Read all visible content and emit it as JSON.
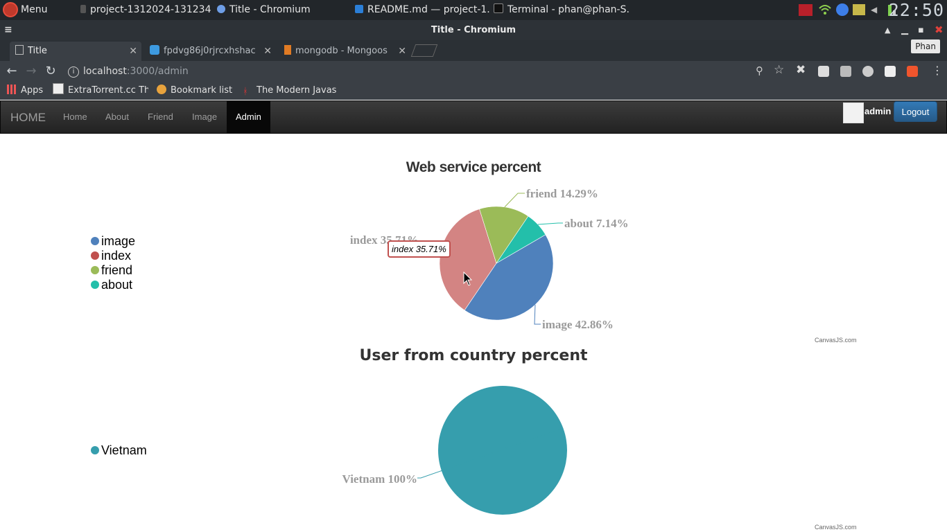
{
  "taskbar": {
    "menu_label": "Menu",
    "tasks": [
      {
        "label": "project-1312024-131234..."
      },
      {
        "label": "Title - Chromium"
      },
      {
        "label": "README.md — project-1..."
      },
      {
        "label": "Terminal - phan@phan-S..."
      }
    ],
    "clock": "22:50"
  },
  "window": {
    "title": "Title - Chromium"
  },
  "tabs": [
    {
      "label": "Title"
    },
    {
      "label": "fpdvg86j0rjrcxhshac"
    },
    {
      "label": "mongodb - Mongoos"
    }
  ],
  "profile": {
    "name": "Phan"
  },
  "address_bar": {
    "host": "localhost",
    "path": ":3000/admin"
  },
  "bookmarks": [
    {
      "label": "Apps"
    },
    {
      "label": "ExtraTorrent.cc Th"
    },
    {
      "label": "Bookmark list"
    },
    {
      "label": "The Modern Javas"
    }
  ],
  "navbar": {
    "brand": "HOME",
    "links": [
      "Home",
      "About",
      "Friend",
      "Image",
      "Admin"
    ],
    "active": "Admin",
    "username": "admin",
    "logout_label": "Logout"
  },
  "colors": {
    "image": "#4f81bc",
    "index": "#c0504e",
    "friend": "#9bbb58",
    "about": "#23bfaa",
    "vietnam": "#369ead"
  },
  "tooltip": "index 35.71%",
  "credit": "CanvasJS.com",
  "chart_data": [
    {
      "type": "pie",
      "title": "Web service percent",
      "legend_placement": "left",
      "labels": [
        "image",
        "index",
        "friend",
        "about"
      ],
      "values": [
        42.86,
        35.71,
        14.29,
        7.14
      ],
      "slice_labels": [
        "image 42.86%",
        "index 35.71%",
        "friend 14.29%",
        "about 7.14%"
      ]
    },
    {
      "type": "pie",
      "title": "User from country percent",
      "legend_placement": "left",
      "labels": [
        "Vietnam"
      ],
      "values": [
        100
      ],
      "slice_labels": [
        "Vietnam 100%"
      ]
    }
  ]
}
